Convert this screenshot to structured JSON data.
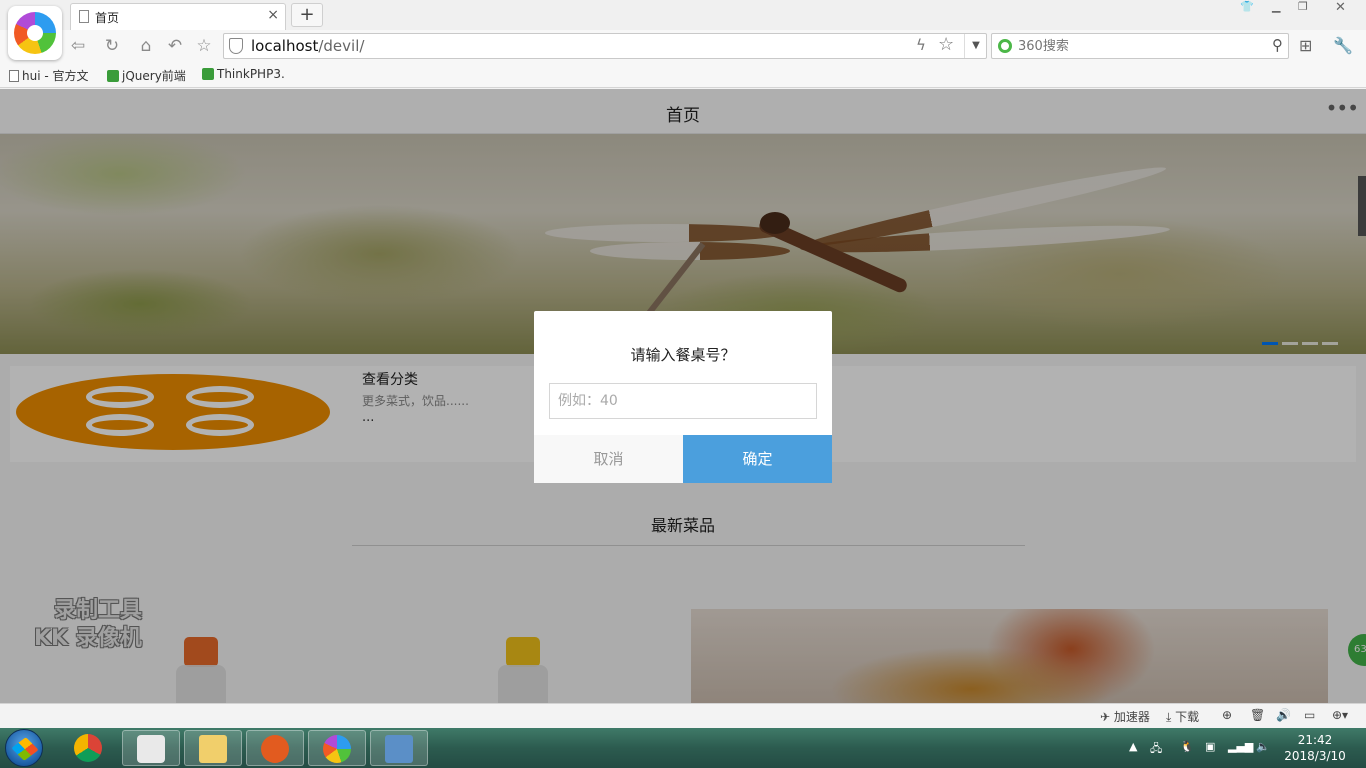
{
  "browser": {
    "tab_title": "首页",
    "tab_close": "×",
    "new_tab": "+",
    "url_host": "localhost",
    "url_path": "/devil/",
    "search_placeholder": "360搜索",
    "bookmarks": [
      "hui - 官方文",
      "jQuery前端",
      "ThinkPHP3."
    ]
  },
  "page": {
    "nav_title": "首页",
    "nav_more": "•••",
    "category": {
      "title": "查看分类",
      "desc": "更多菜式，饮品......",
      "ellipsis": "..."
    },
    "section_title": "最新菜品",
    "watermark_line1": "录制工具",
    "watermark_line2": "KK 录像机",
    "side_badge": "63"
  },
  "dialog": {
    "title": "请输入餐桌号？",
    "input_placeholder": "例如：40",
    "cancel_label": "取消",
    "ok_label": "确定"
  },
  "statusbar": {
    "accelerator": "加速器",
    "download": "下载"
  },
  "taskbar": {
    "time": "21:42",
    "date": "2018/3/10"
  },
  "colors": {
    "primary_button": "#4b9fdd",
    "carousel_active": "#007aff",
    "category_logo": "#f08f00"
  }
}
